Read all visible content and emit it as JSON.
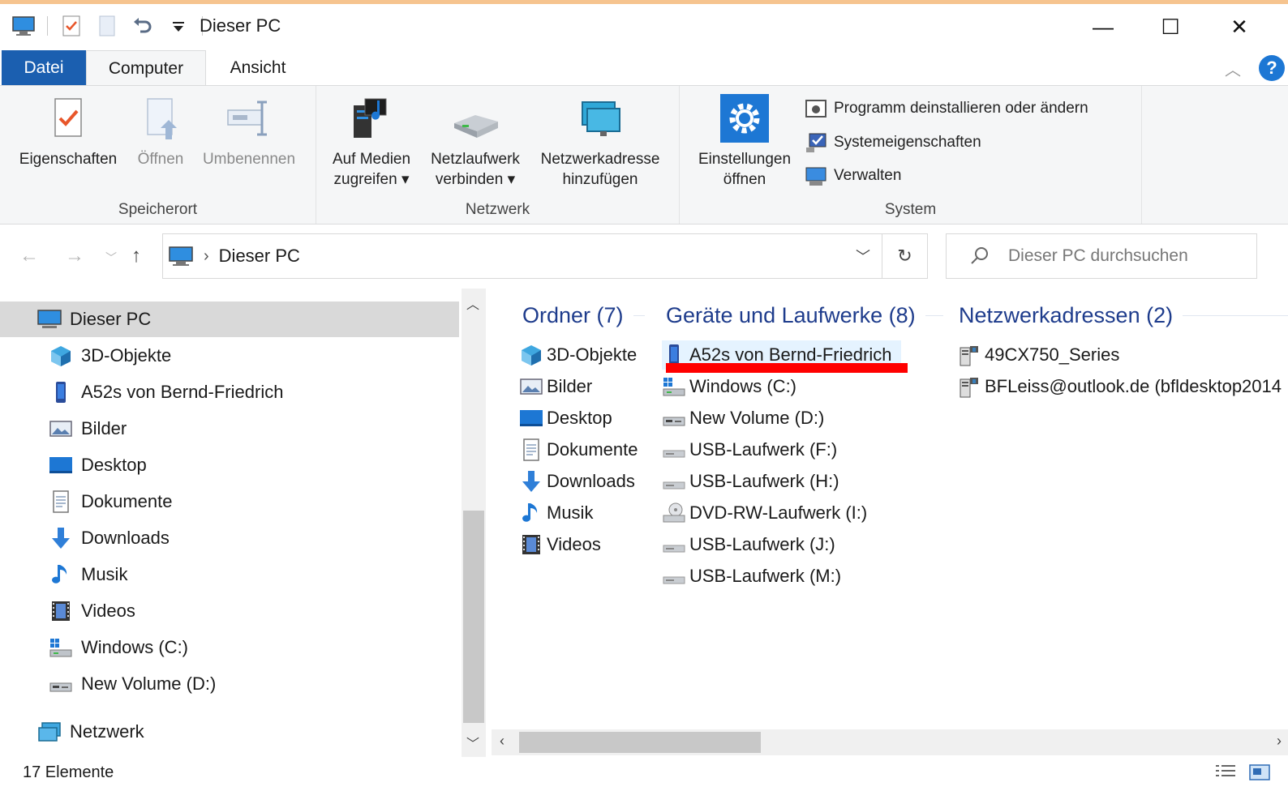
{
  "window": {
    "title": "Dieser PC",
    "minimize": "—",
    "maximize": "☐",
    "close": "✕"
  },
  "tabs": {
    "file": "Datei",
    "computer": "Computer",
    "view": "Ansicht",
    "help": "?"
  },
  "ribbon": {
    "speicherort": {
      "label": "Speicherort",
      "eigenschaften": "Eigenschaften",
      "oeffnen": "Öffnen",
      "umbenennen": "Umbenennen"
    },
    "netzwerk": {
      "label": "Netzwerk",
      "medien_line1": "Auf Medien",
      "medien_line2": "zugreifen ▾",
      "netzlaufwerk_line1": "Netzlaufwerk",
      "netzlaufwerk_line2": "verbinden ▾",
      "netzwerkadresse_line1": "Netzwerkadresse",
      "netzwerkadresse_line2": "hinzufügen"
    },
    "system": {
      "label": "System",
      "einstellungen_line1": "Einstellungen",
      "einstellungen_line2": "öffnen",
      "programm": "Programm deinstallieren oder ändern",
      "systemeigenschaften": "Systemeigenschaften",
      "verwalten": "Verwalten"
    }
  },
  "address": {
    "crumb": "Dieser PC",
    "search_placeholder": "Dieser PC durchsuchen"
  },
  "nav": {
    "items": [
      {
        "label": "Dieser PC",
        "icon": "pc-icon"
      },
      {
        "label": "3D-Objekte",
        "icon": "3d-objects-icon"
      },
      {
        "label": "A52s von Bernd-Friedrich",
        "icon": "phone-icon"
      },
      {
        "label": "Bilder",
        "icon": "pictures-icon"
      },
      {
        "label": "Desktop",
        "icon": "desktop-icon"
      },
      {
        "label": "Dokumente",
        "icon": "documents-icon"
      },
      {
        "label": "Downloads",
        "icon": "downloads-icon"
      },
      {
        "label": "Musik",
        "icon": "music-icon"
      },
      {
        "label": "Videos",
        "icon": "videos-icon"
      },
      {
        "label": "Windows (C:)",
        "icon": "windows-drive-icon"
      },
      {
        "label": "New Volume (D:)",
        "icon": "drive-icon"
      },
      {
        "label": "Netzwerk",
        "icon": "network-icon"
      }
    ]
  },
  "content": {
    "folders_header": "Ordner (7)",
    "devices_header": "Geräte und Laufwerke (8)",
    "network_header": "Netzwerkadressen (2)",
    "folders": [
      "3D-Objekte",
      "Bilder",
      "Desktop",
      "Dokumente",
      "Downloads",
      "Musik",
      "Videos"
    ],
    "devices": [
      "A52s von Bernd-Friedrich",
      "Windows (C:)",
      "New Volume (D:)",
      "USB-Laufwerk (F:)",
      "USB-Laufwerk (H:)",
      "DVD-RW-Laufwerk (I:)",
      "USB-Laufwerk (J:)",
      "USB-Laufwerk (M:)"
    ],
    "network": [
      "49CX750_Series",
      "BFLeiss@outlook.de (bfldesktop2014"
    ]
  },
  "status": {
    "count": "17 Elemente"
  },
  "colors": {
    "accent": "#1b5fb0",
    "header_text": "#1e3c8c",
    "selection": "#d9d9d9",
    "highlight": "#e5f3ff",
    "annotation": "#ff0000"
  }
}
